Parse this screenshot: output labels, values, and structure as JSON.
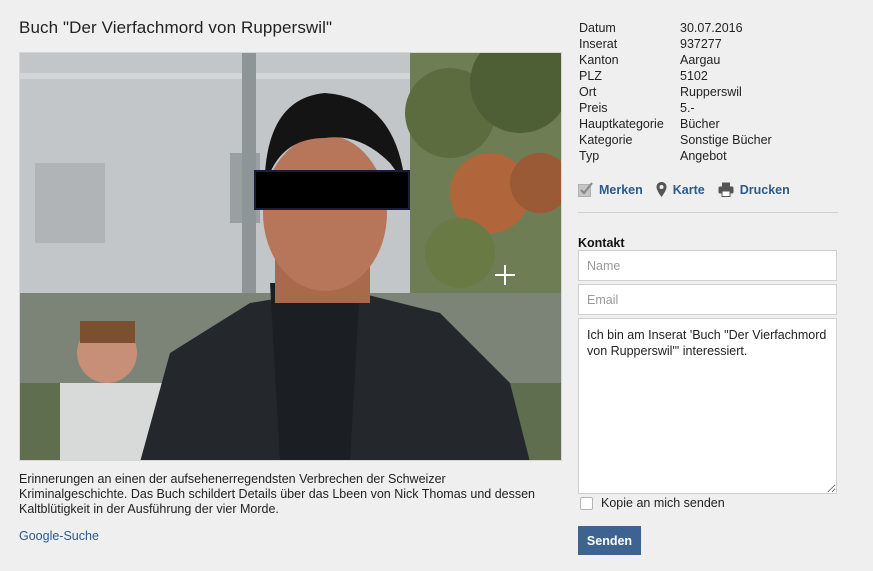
{
  "listing": {
    "title": "Buch \"Der Vierfachmord von Rupperswil\"",
    "description": "Erinnerungen an einen der aufsehenerregendsten Verbrechen der Schweizer Kriminalgeschichte. Das Buch schildert Details über das Lbeen von Nick Thomas und dessen Kaltblütigkeit in der Ausführung der vier Morde.",
    "google_link": "Google-Suche"
  },
  "details": [
    {
      "key": "Datum",
      "value": "30.07.2016"
    },
    {
      "key": "Inserat",
      "value": "937277"
    },
    {
      "key": "Kanton",
      "value": "Aargau"
    },
    {
      "key": "PLZ",
      "value": "5102"
    },
    {
      "key": "Ort",
      "value": "Rupperswil"
    },
    {
      "key": "Preis",
      "value": "5.-"
    },
    {
      "key": "Hauptkategorie",
      "value": "Bücher"
    },
    {
      "key": "Kategorie",
      "value": "Sonstige Bücher"
    },
    {
      "key": "Typ",
      "value": "Angebot"
    }
  ],
  "actions": {
    "merken": {
      "label": "Merken",
      "icon": "checkbox-icon"
    },
    "karte": {
      "label": "Karte",
      "icon": "map-pin-icon"
    },
    "drucken": {
      "label": "Drucken",
      "icon": "printer-icon"
    }
  },
  "contact": {
    "heading": "Kontakt",
    "name_placeholder": "Name",
    "name_value": "",
    "email_placeholder": "Email",
    "email_value": "",
    "message_value": "Ich bin am Inserat 'Buch \"Der Vierfachmord von Rupperswil\"' interessiert.",
    "copy_label": "Kopie an mich senden",
    "copy_checked": false,
    "send_label": "Senden"
  },
  "colors": {
    "accent": "#3d6491",
    "link": "#2c5a8a",
    "background": "#efefef"
  }
}
